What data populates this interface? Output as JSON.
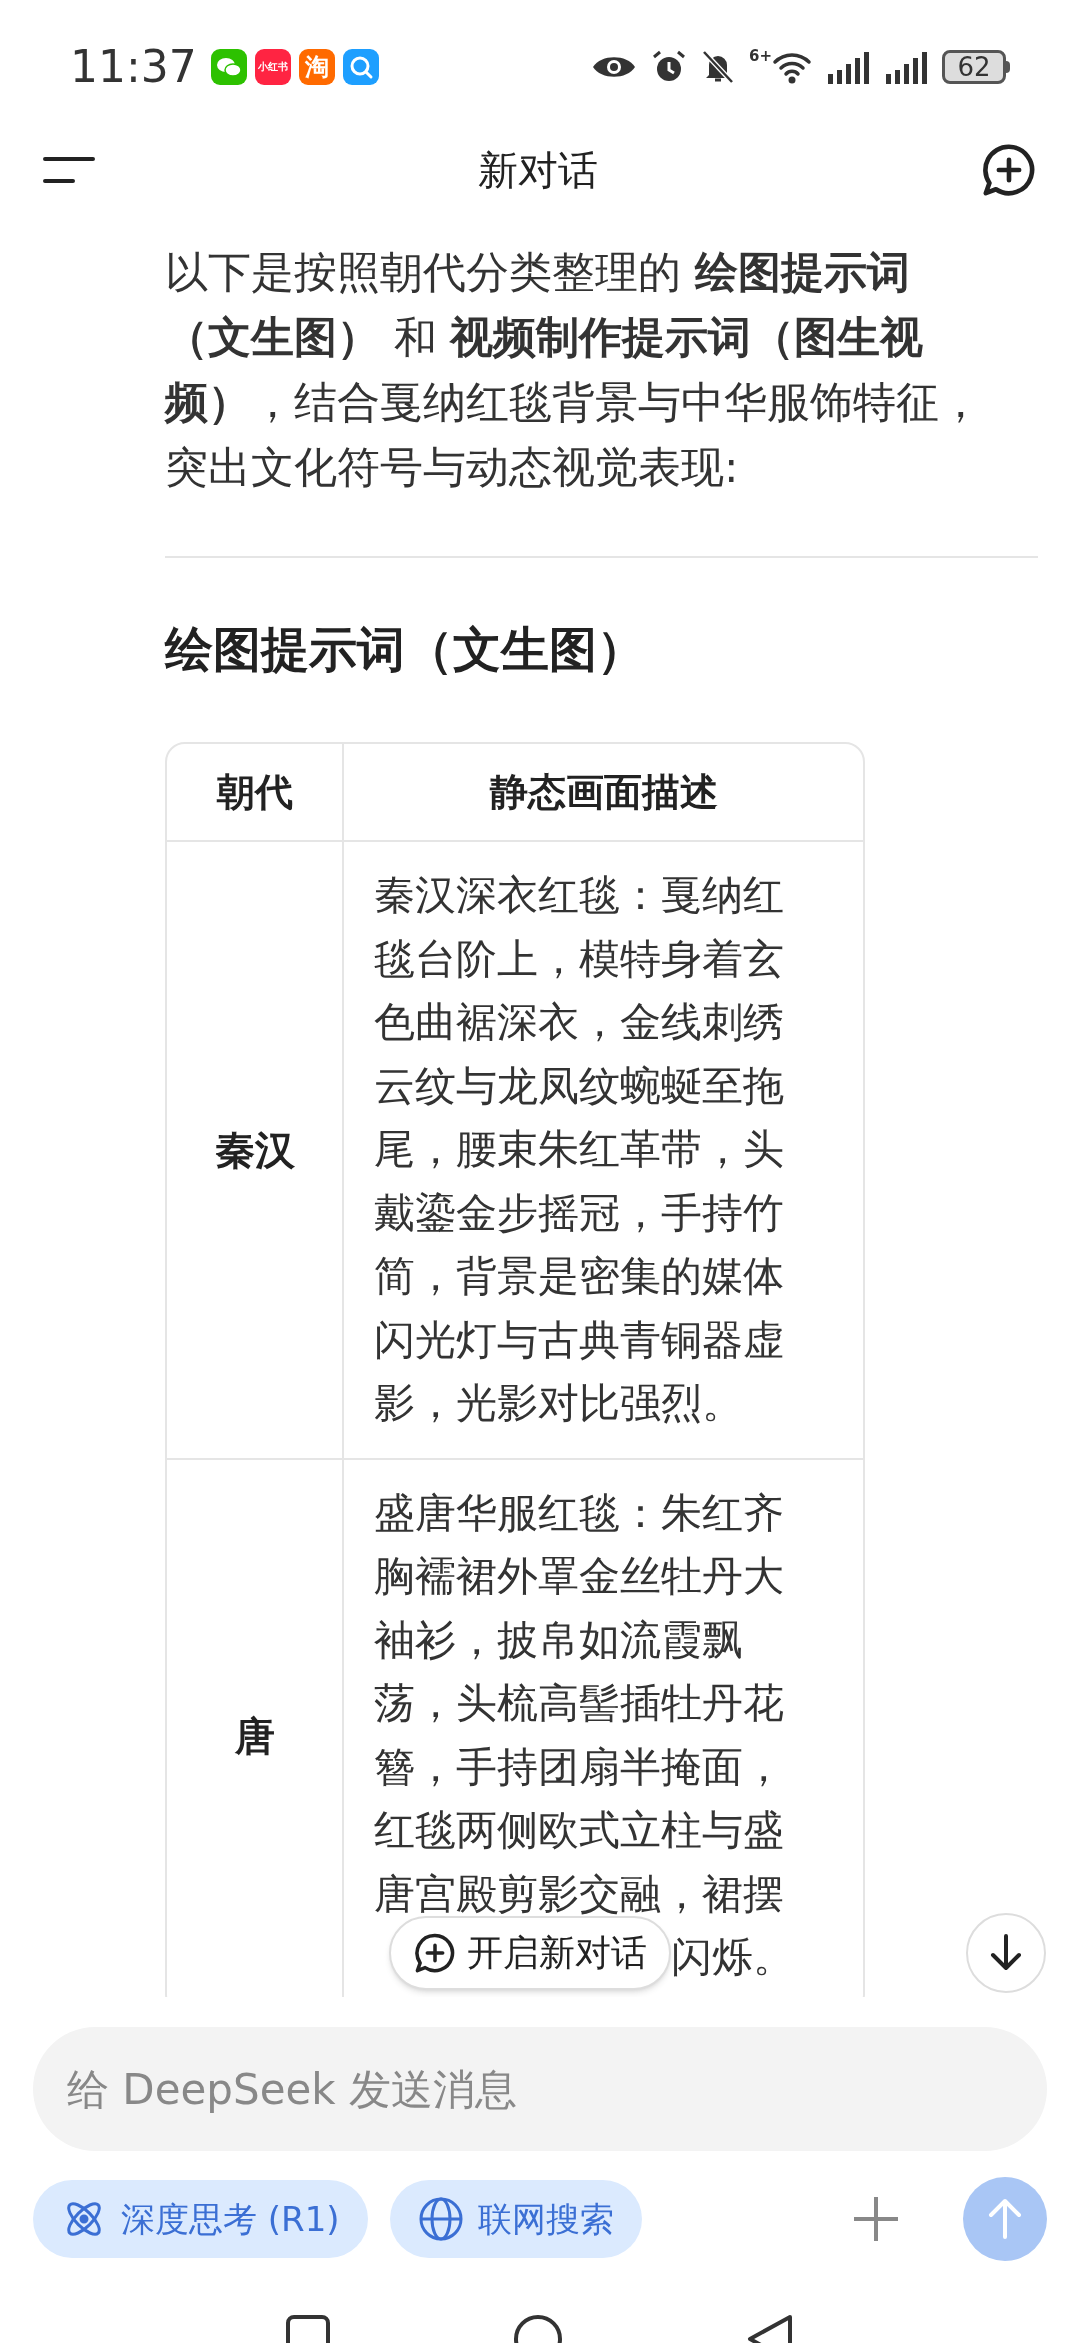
{
  "status_bar": {
    "time": "11:37",
    "app_icons": [
      {
        "kind": "chat",
        "color": "#2dc100"
      },
      {
        "kind": "text",
        "label": "小红书",
        "color": "#ff2442"
      },
      {
        "kind": "text",
        "label": "淘",
        "color": "#ff6a00"
      },
      {
        "kind": "search",
        "color": "#1e9fff"
      }
    ],
    "wifi_label": "6+",
    "battery": "62"
  },
  "header": {
    "title": "新对话"
  },
  "message": {
    "intro": "以下是按照朝代分类整理的 **绘图提示词（文生图）** 和 **视频制作提示词（图生视频）**，结合戛纳红毯背景与中华服饰特征，突出文化符号与动态视觉表现:",
    "heading": "绘图提示词（文生图）",
    "table": {
      "columns": [
        "朝代",
        "静态画面描述"
      ],
      "rows": [
        {
          "dynasty": "秦汉",
          "description": "秦汉深衣红毯：戛纳红毯台阶上，模特身着玄色曲裾深衣，金线刺绣云纹与龙凤纹蜿蜒至拖尾，腰束朱红革带，头戴鎏金步摇冠，手持竹简，背景是密集的媒体闪光灯与古典青铜器虚影，光影对比强烈。",
          "partial_line": []
        },
        {
          "dynasty": "唐",
          "description": "盛唐华服红毯：朱红齐胸襦裙外罩金丝牡丹大袖衫，披帛如流霞飘荡，头梳高髻插牡丹花簪，手持团扇半掩面，红毯两侧欧式立柱与盛唐宫殿剪影交融，裙摆",
          "partial_line": [
            "闪烁。"
          ]
        }
      ]
    }
  },
  "new_chat_button": {
    "label": "开启新对话"
  },
  "input": {
    "placeholder": "给 DeepSeek 发送消息",
    "chips": [
      {
        "kind": "think",
        "label": "深度思考 (R1)",
        "on": true
      },
      {
        "kind": "search",
        "label": "联网搜索",
        "on": true
      }
    ],
    "send_disabled": true
  }
}
